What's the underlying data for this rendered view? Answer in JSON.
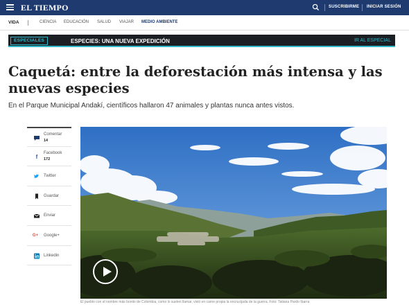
{
  "header": {
    "brand": "EL TIEMPO",
    "subscribe": "SUSCRIBIRME",
    "login": "INICIAR SESIÓN"
  },
  "section_nav": {
    "section": "VIDA",
    "items": [
      "CIENCIA",
      "EDUCACIÓN",
      "SALUD",
      "VIAJAR",
      "MEDIO AMBIENTE"
    ],
    "active": "MEDIO AMBIENTE"
  },
  "especial": {
    "badge": "ESPECIALES",
    "title": "ESPECIES: UNA NUEVA EXPEDICIÓN",
    "cta": "IR AL ESPECIAL"
  },
  "article": {
    "title": "Caquetá: entre la deforestación más intensa y las nuevas especies",
    "lead": "En el Parque Municipal Andakí, científicos hallaron 47 animales y plantas nunca antes vistos.",
    "caption": "El pueblo con el nombre más bonito de Colombia, como lo suelen llamar, vivió en carne propia la encrucijada de la guerra. Foto: Tatiana Pardo Ibarra"
  },
  "share": {
    "comment_label": "Comentar",
    "comment_count": "14",
    "facebook_label": "Facebook",
    "facebook_count": "172",
    "twitter_label": "Twitter",
    "save_label": "Guardar",
    "send_label": "Enviar",
    "google_label": "Google+",
    "linkedin_label": "Linkedin"
  },
  "colors": {
    "header_bg": "#1e3a6e",
    "accent": "#2fb8c8",
    "banner_bg": "#1b1f24"
  }
}
